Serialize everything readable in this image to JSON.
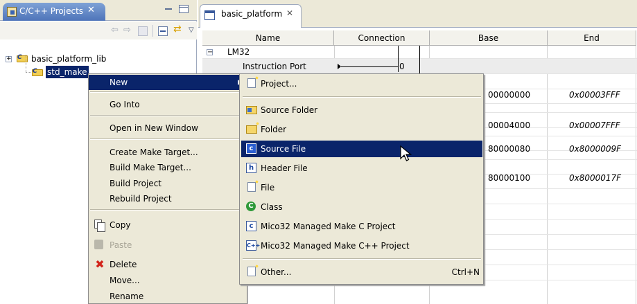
{
  "left_view": {
    "tab_title": "C/C++ Projects",
    "tree": [
      {
        "label": "basic_platform_lib",
        "expanded": false
      },
      {
        "label": "std_make",
        "selected": true
      }
    ]
  },
  "editor": {
    "tab_title": "basic_platform",
    "columns": [
      "Name",
      "Connection",
      "Base",
      "End"
    ],
    "rows": [
      {
        "name": "LM32",
        "group": true
      },
      {
        "name": "Instruction Port",
        "connection": "0"
      }
    ],
    "base_values": [
      "00000000",
      "00004000",
      "80000080",
      "80000100"
    ],
    "end_values": [
      "0x00003FFF",
      "0x00007FFF",
      "0x8000009F",
      "0x8000017F"
    ]
  },
  "context_menu": {
    "items": [
      {
        "label": "New",
        "submenu": true,
        "selected": true
      },
      {
        "label": "Go Into"
      },
      {
        "label": "Open in New Window"
      },
      {
        "label": "Create Make Target..."
      },
      {
        "label": "Build Make Target..."
      },
      {
        "label": "Build Project"
      },
      {
        "label": "Rebuild Project"
      },
      {
        "label": "Copy",
        "icon": "copy-icon"
      },
      {
        "label": "Paste",
        "icon": "paste-icon",
        "disabled": true
      },
      {
        "label": "Delete",
        "icon": "delete-icon"
      },
      {
        "label": "Move..."
      },
      {
        "label": "Rename"
      }
    ]
  },
  "submenu": {
    "items": [
      {
        "label": "Project...",
        "icon": "new-project-icon"
      },
      {
        "label": "Source Folder",
        "icon": "source-folder-icon"
      },
      {
        "label": "Folder",
        "icon": "new-folder-icon"
      },
      {
        "label": "Source File",
        "icon": "source-file-icon",
        "selected": true
      },
      {
        "label": "Header File",
        "icon": "header-file-icon"
      },
      {
        "label": "File",
        "icon": "new-file-icon"
      },
      {
        "label": "Class",
        "icon": "class-icon"
      },
      {
        "label": "Mico32 Managed Make C Project",
        "icon": "c-project-icon"
      },
      {
        "label": "Mico32 Managed Make C++ Project",
        "icon": "cpp-project-icon"
      },
      {
        "label": "Other...",
        "icon": "other-icon",
        "shortcut": "Ctrl+N"
      }
    ]
  },
  "colors": {
    "selection": "#0a246a",
    "menu_bg": "#ece9d8",
    "tab_active": "#4e74b9"
  }
}
